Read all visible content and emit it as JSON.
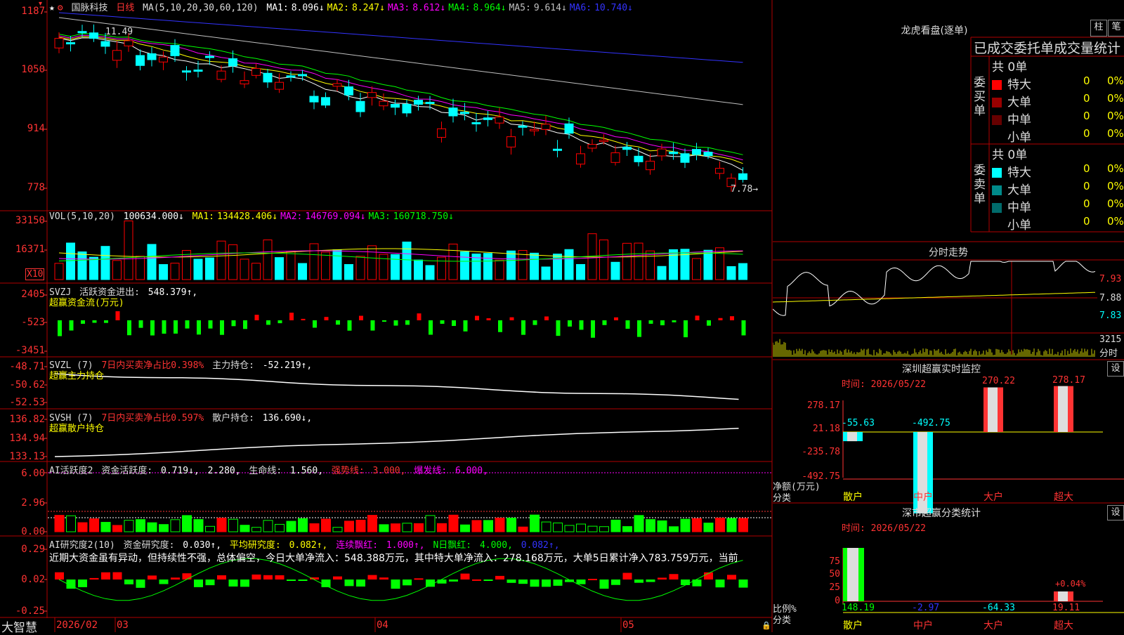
{
  "main": {
    "stock_name": "国脉科技",
    "period": "日线",
    "ma_label": "MA(5,10,20,30,60,120)",
    "ma": [
      {
        "name": "MA1:",
        "value": "8.096↓",
        "color": "#ffffff"
      },
      {
        "name": "MA2:",
        "value": "8.247↓",
        "color": "#ffff00"
      },
      {
        "name": "MA3:",
        "value": "8.612↓",
        "color": "#ff00ff"
      },
      {
        "name": "MA4:",
        "value": "8.964↓",
        "color": "#00ff00"
      },
      {
        "name": "MA5:",
        "value": "9.614↓",
        "color": "#c0c0c0"
      },
      {
        "name": "MA6:",
        "value": "10.740↓",
        "color": "#3333ff"
      }
    ],
    "y_ticks": [
      "1187",
      "1050",
      "914",
      "778"
    ],
    "high_marker": "11.49",
    "low_marker": "7.78→"
  },
  "vol": {
    "header": "VOL(5,10,20)",
    "value": "100634.000↓",
    "ma": [
      {
        "name": "MA1:",
        "value": "134428.406↓",
        "color": "#ffff00"
      },
      {
        "name": "MA2:",
        "value": "146769.094↓",
        "color": "#ff00ff"
      },
      {
        "name": "MA3:",
        "value": "160718.750↓",
        "color": "#00ff00"
      }
    ],
    "y_ticks": [
      "33150",
      "16371"
    ],
    "unit": "X10"
  },
  "svzj": {
    "title": "SVZJ",
    "item": "活跃资金进出:",
    "value": "548.379↑,",
    "subtitle": "超赢资金流(万元)",
    "y_ticks": [
      "2405",
      "-523",
      "-3451"
    ]
  },
  "svzl": {
    "title": "SVZL (7)",
    "item1": "7日内买卖净占比0.398%",
    "item2": "主力持仓:",
    "value": "-52.219↑,",
    "subtitle": "超赢主力持仓",
    "y_ticks": [
      "-48.71",
      "-50.62",
      "-52.53"
    ]
  },
  "svsh": {
    "title": "SVSH (7)",
    "item1": "7日内买卖净占比0.597%",
    "item2": "散户持仓:",
    "value": "136.690↓,",
    "subtitle": "超赢散户持仓",
    "y_ticks": [
      "136.82",
      "134.94",
      "133.13"
    ]
  },
  "ai_active": {
    "title": "AI活跃度2",
    "item1": "资金活跃度:",
    "value1": "0.719↓,",
    "value2": "2.280,",
    "item3": "生命线:",
    "value3": "1.560,",
    "item4": "强势线:",
    "value4": "3.000,",
    "item5": "爆发线:",
    "value5": "6.000,",
    "y_ticks": [
      "6.00",
      "2.96",
      "0.00"
    ]
  },
  "ai_research": {
    "title": "AI研究度2(10)",
    "item1": "资金研究度:",
    "value1": "0.030↑,",
    "item2": "平均研究度:",
    "value2": "0.082↑,",
    "item3": "连续飘红:",
    "value3": "1.000↑,",
    "item4": "N日飘红:",
    "value4": "4.000,",
    "value5": "0.082↑,",
    "commentary": "近期大资金虽有异动，但持续性不强，总体偏空，今日大单净流入：548.388万元，其中特大单净流入：278.168万元，大单5日累计净入783.759万元，当前",
    "y_ticks": [
      "0.29",
      "0.02",
      "-0.25"
    ]
  },
  "time_axis": {
    "brand": "大智慧",
    "labels": [
      "2026/02",
      "03",
      "04",
      "05"
    ]
  },
  "dragon": {
    "title": "龙虎看盘(逐单)",
    "btn1": "柱",
    "btn2": "笔",
    "header": "已成交委托单成交量统计",
    "buy": {
      "side_label": "委买单",
      "total": "共 0单",
      "rows": [
        {
          "label": "特大",
          "count": "0",
          "pct": "0%",
          "color": "#ff0000"
        },
        {
          "label": "大单",
          "count": "0",
          "pct": "0%",
          "color": "#990000"
        },
        {
          "label": "中单",
          "count": "0",
          "pct": "0%",
          "color": "#660000"
        },
        {
          "label": "小单",
          "count": "0",
          "pct": "0%",
          "color": ""
        }
      ]
    },
    "sell": {
      "side_label": "委卖单",
      "total": "共 0单",
      "rows": [
        {
          "label": "特大",
          "count": "0",
          "pct": "0%",
          "color": "#00ffff"
        },
        {
          "label": "大单",
          "count": "0",
          "pct": "0%",
          "color": "#008b8b"
        },
        {
          "label": "中单",
          "count": "0",
          "pct": "0%",
          "color": "#006b6b"
        },
        {
          "label": "小单",
          "count": "0",
          "pct": "0%",
          "color": ""
        }
      ]
    }
  },
  "intraday": {
    "title": "分时走势",
    "price_ticks": [
      "7.93",
      "7.88",
      "7.83"
    ],
    "vol_tick": "3215",
    "vol_unit": "分时"
  },
  "sz_monitor": {
    "title": "深圳超赢实时监控",
    "btn": "设",
    "time": "时间: 2026/05/22",
    "y_ticks": [
      "278.17",
      "21.18",
      "-235.78",
      "-492.75"
    ],
    "y_caption": "净额(万元)",
    "x_caption": "分类",
    "categories": [
      "散户",
      "中户",
      "大户",
      "超大"
    ],
    "values": [
      "-55.63",
      "-492.75",
      "270.22",
      "278.17"
    ],
    "value_nums": [
      -55.63,
      -492.75,
      270.22,
      278.17
    ]
  },
  "sz_class": {
    "title": "深市超赢分类统计",
    "btn": "设",
    "time": "时间: 2026/05/22",
    "y_ticks": [
      "75",
      "50",
      "25",
      "0"
    ],
    "y_caption": "比例%",
    "x_caption": "分类",
    "categories": [
      "散户",
      "中户",
      "大户",
      "超大"
    ],
    "values": [
      "148.19",
      "-2.97",
      "-64.33",
      "19.11"
    ],
    "annotation": "+0.04%"
  },
  "colors": {
    "up": "#ff0000",
    "down": "#00ffff",
    "axis": "#b00000",
    "label_red": "#ff3333",
    "yellow": "#ffff00"
  }
}
